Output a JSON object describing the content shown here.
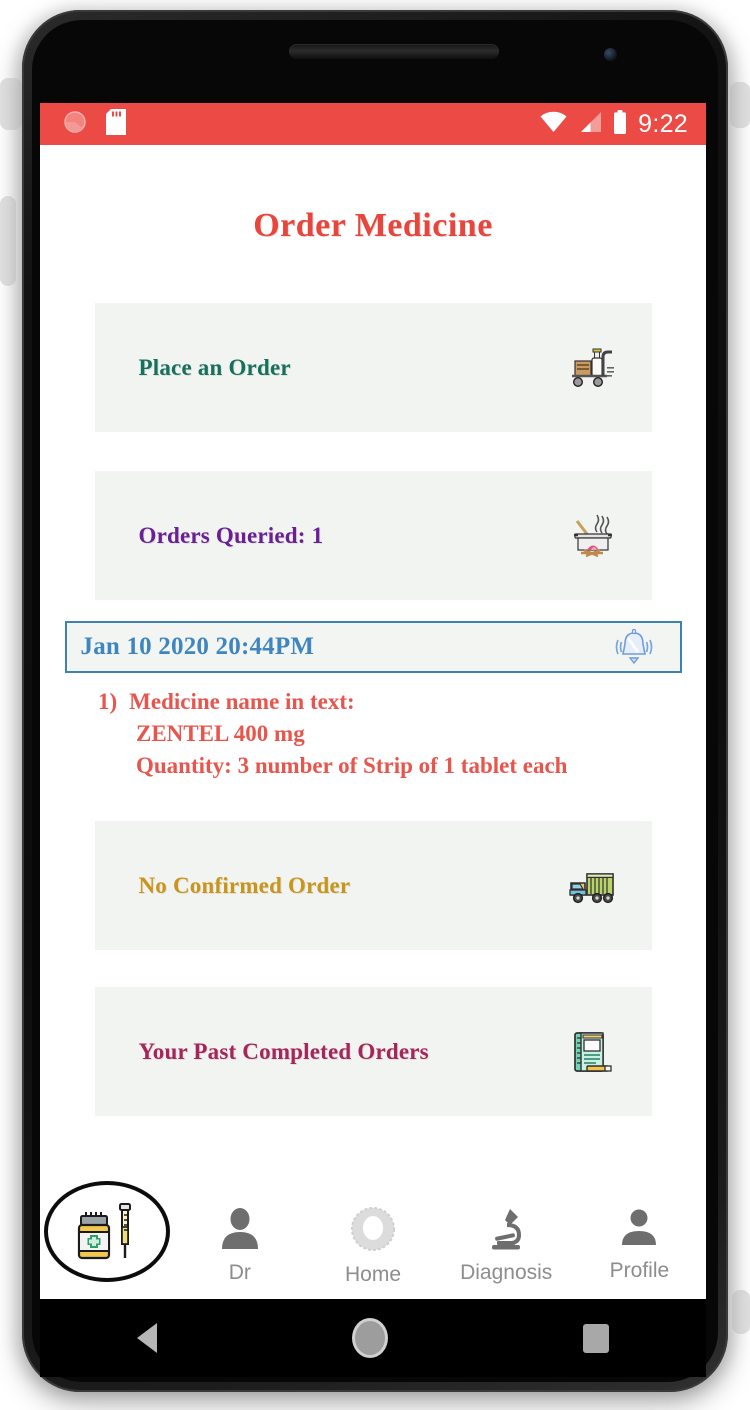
{
  "statusbar": {
    "time": "9:22",
    "left_icons": [
      "notification-dot-icon",
      "sd-card-icon"
    ],
    "right_icons": [
      "wifi-icon",
      "cellular-signal-icon",
      "battery-icon"
    ],
    "bg_color": "#ec4a44"
  },
  "header": {
    "title": "Order Medicine",
    "title_color": "#e8453c"
  },
  "cards": [
    {
      "label": "Place an Order",
      "color": "#16705c",
      "icon": "delivery-trolley-icon"
    },
    {
      "label": "Orders Queried: 1",
      "color": "#6a2094",
      "icon": "cooking-pot-icon"
    },
    {
      "label": "No Confirmed Order",
      "color": "#c9951b",
      "icon": "delivery-truck-icon"
    },
    {
      "label": "Your Past Completed Orders",
      "color": "#a6255a",
      "icon": "notebook-icon"
    }
  ],
  "notification": {
    "timestamp": "Jan 10 2020 20:44PM",
    "text_color": "#3f86c0",
    "border_color": "#3c83b4",
    "icon": "ringing-bell-icon"
  },
  "order_detail": {
    "index": "1)",
    "line1": "Medicine name in text:",
    "line2": "ZENTEL 400 mg",
    "line3": "Quantity: 3 number of Strip of 1 tablet each",
    "color": "#e8554c"
  },
  "bottom_nav": {
    "items": [
      {
        "label": "",
        "icon": "medicine-bottle-syringe-icon",
        "active": true
      },
      {
        "label": "Dr",
        "icon": "doctor-person-icon",
        "active": false
      },
      {
        "label": "Home",
        "icon": "home-ring-icon",
        "active": false
      },
      {
        "label": "Diagnosis",
        "icon": "microscope-icon",
        "active": false
      },
      {
        "label": "Profile",
        "icon": "person-profile-icon",
        "active": false
      }
    ]
  },
  "android_nav": {
    "back": "back-triangle-icon",
    "home": "home-circle-icon",
    "recents": "recents-square-icon"
  }
}
